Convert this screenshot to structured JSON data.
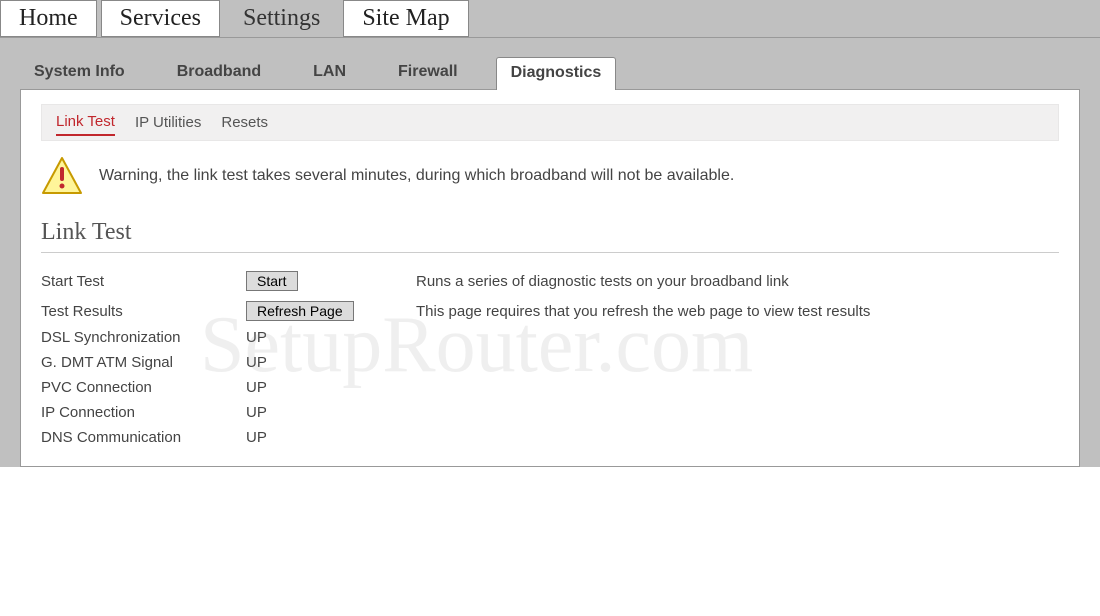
{
  "topNav": {
    "tabs": [
      "Home",
      "Services",
      "Settings",
      "Site Map"
    ],
    "active": 2
  },
  "subNav": {
    "tabs": [
      "System Info",
      "Broadband",
      "LAN",
      "Firewall",
      "Diagnostics"
    ],
    "active": 4
  },
  "tertiaryNav": {
    "tabs": [
      "Link Test",
      "IP Utilities",
      "Resets"
    ],
    "active": 0
  },
  "warning": {
    "text": "Warning, the link test takes several minutes, during which broadband will not be available."
  },
  "section": {
    "title": "Link Test"
  },
  "rows": {
    "startTest": {
      "label": "Start Test",
      "button": "Start",
      "desc": "Runs a series of diagnostic tests on your broadband link"
    },
    "testResults": {
      "label": "Test Results",
      "button": "Refresh Page",
      "desc": "This page requires that you refresh the web page to view test results"
    }
  },
  "results": [
    {
      "name": "DSL Synchronization",
      "value": "UP"
    },
    {
      "name": "G. DMT ATM Signal",
      "value": "UP"
    },
    {
      "name": "PVC Connection",
      "value": "UP"
    },
    {
      "name": "IP Connection",
      "value": "UP"
    },
    {
      "name": "DNS Communication",
      "value": "UP"
    }
  ],
  "watermark": "SetupRouter.com"
}
